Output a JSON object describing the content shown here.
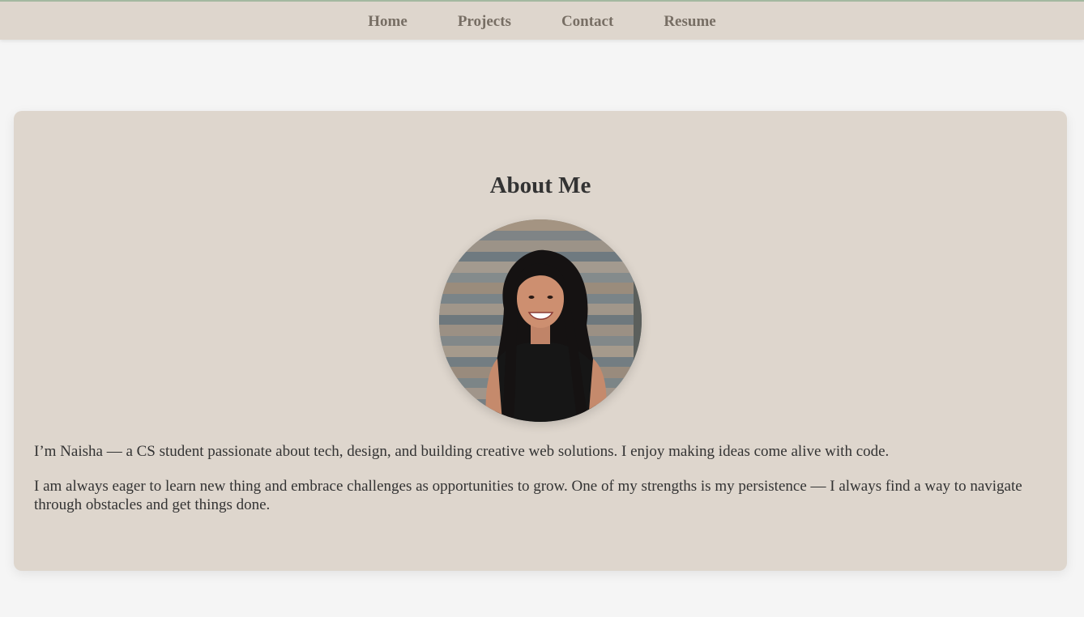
{
  "nav": {
    "items": [
      {
        "label": "Home"
      },
      {
        "label": "Projects"
      },
      {
        "label": "Contact"
      },
      {
        "label": "Resume"
      }
    ]
  },
  "about": {
    "title": "About Me",
    "photo_icon": "profile-photo",
    "paragraphs": [
      "I’m Naisha — a CS student passionate about tech, design, and building creative web solutions. I enjoy making ideas come alive with code.",
      "I am always eager to learn new thing and embrace challenges as opportunities to grow. One of my strengths is my persistence — I always find a way to navigate through obstacles and get things done."
    ]
  },
  "colors": {
    "background": "#f5f5f5",
    "nav_background": "#ded6cd",
    "nav_link": "#776e64",
    "card_background": "#ded6cd",
    "text": "#333333",
    "accent_border": "#a3b8a0"
  }
}
